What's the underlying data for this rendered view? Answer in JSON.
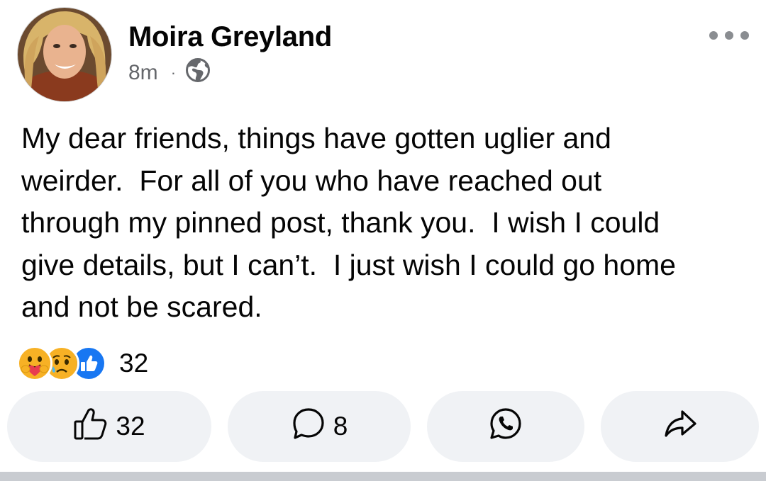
{
  "post": {
    "author_name": "Moira Greyland",
    "timestamp": "8m",
    "separator": "·",
    "audience_icon": "globe-icon",
    "more_icon": "more-options-icon",
    "text": "My dear friends, things have gotten uglier and\nweirder.  For all of you who have reached out\nthrough my pinned post, thank you.  I wish I could\ngive details, but I can’t.  I just wish I could go home\nand not be scared."
  },
  "reactions": {
    "icons": [
      "care-reaction-icon",
      "sad-reaction-icon",
      "like-reaction-icon"
    ],
    "count": "32"
  },
  "actions": {
    "like": {
      "icon": "thumbs-up-icon",
      "count": "32"
    },
    "comment": {
      "icon": "comment-icon",
      "count": "8"
    },
    "whatsapp": {
      "icon": "whatsapp-icon"
    },
    "share": {
      "icon": "share-arrow-icon"
    }
  },
  "colors": {
    "text": "#050505",
    "secondary_text": "#65676b",
    "button_bg": "#f0f2f5",
    "like_blue": "#1877f2",
    "reaction_yellow": "#f7b125"
  }
}
